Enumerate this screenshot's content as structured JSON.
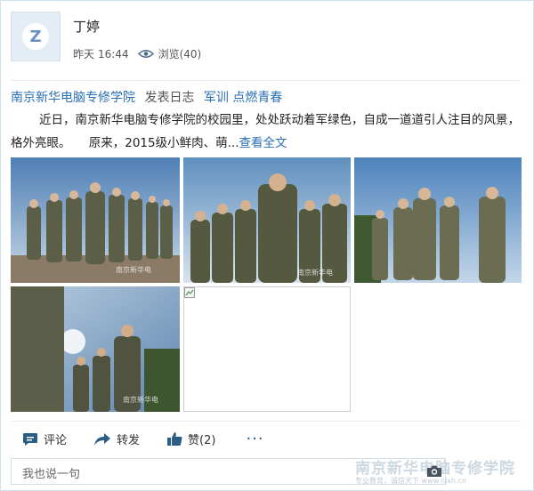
{
  "post": {
    "username": "丁婷",
    "time_day": "昨天",
    "time_clock": "16:44",
    "views_label": "浏览(40)",
    "author_link": "南京新华电脑专修学院",
    "action_text": "发表日志",
    "subject": "军训 点燃青春",
    "body": "近日，南京新华电脑专修学院的校园里，处处跃动着军绿色，自成一道道引人注目的风景，格外亮眼。　　原来，2015级小鲜肉、萌...",
    "more_link": "查看全文"
  },
  "photos": [
    {
      "watermark": "南京新华电"
    },
    {
      "watermark": "南京新华电"
    },
    {
      "watermark": ""
    },
    {
      "watermark": "南京新华电"
    },
    {
      "watermark": ""
    }
  ],
  "actions": {
    "comment": "评论",
    "share": "转发",
    "like": "赞(2)",
    "more": "···"
  },
  "comment_box": {
    "placeholder": "我也说一句"
  },
  "watermark": {
    "brand": "南京新华电脑专修学院",
    "sub": "专业教育，诚信天下  www.njxh.cn"
  },
  "colors": {
    "link": "#2a6fb3",
    "icon": "#2b5d85",
    "border": "#cfe3ec"
  }
}
